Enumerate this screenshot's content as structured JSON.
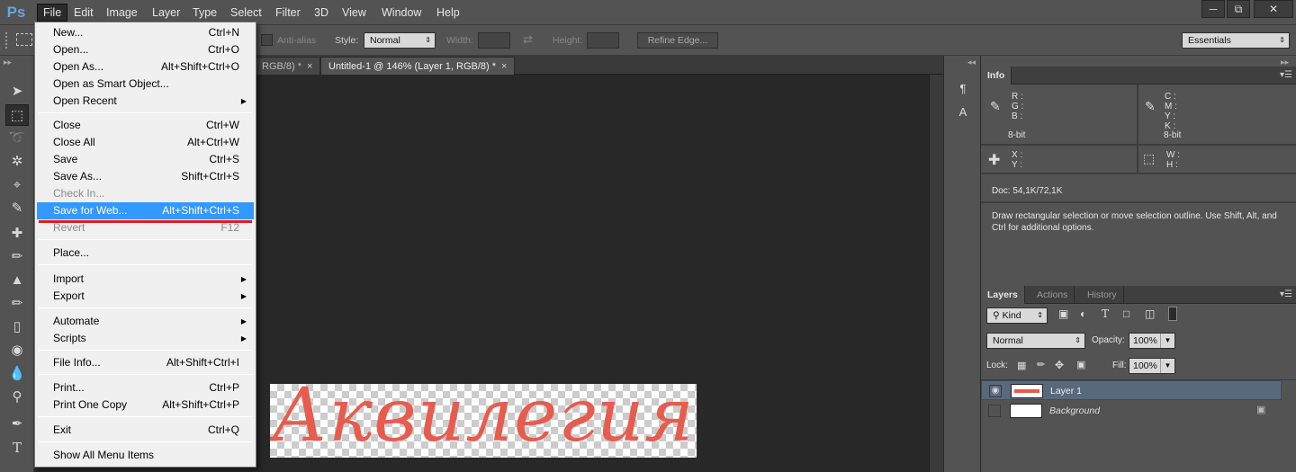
{
  "app": {
    "logo": "Ps"
  },
  "menubar": {
    "items": [
      "File",
      "Edit",
      "Image",
      "Layer",
      "Type",
      "Select",
      "Filter",
      "3D",
      "View",
      "Window",
      "Help"
    ],
    "window_buttons": [
      "minimize-icon",
      "restore-icon",
      "close-icon"
    ]
  },
  "options": {
    "antialias_label": "Anti-alias",
    "style_label": "Style:",
    "style_value": "Normal",
    "width_label": "Width:",
    "height_label": "Height:",
    "refine_edge": "Refine Edge...",
    "workspace": "Essentials"
  },
  "tabs": [
    {
      "label": "RGB/8) *",
      "active": false
    },
    {
      "label": "Untitled-1 @ 146% (Layer 1, RGB/8) *",
      "active": true
    }
  ],
  "canvas": {
    "text": "Аквилегия",
    "text_color": "#e65c4f"
  },
  "file_menu": {
    "items": [
      {
        "label": "New...",
        "shortcut": "Ctrl+N"
      },
      {
        "label": "Open...",
        "shortcut": "Ctrl+O"
      },
      {
        "label": "Open As...",
        "shortcut": "Alt+Shift+Ctrl+O"
      },
      {
        "label": "Open as Smart Object...",
        "shortcut": ""
      },
      {
        "label": "Open Recent",
        "shortcut": "",
        "submenu": true
      },
      {
        "label": "Close",
        "shortcut": "Ctrl+W"
      },
      {
        "label": "Close All",
        "shortcut": "Alt+Ctrl+W"
      },
      {
        "label": "Save",
        "shortcut": "Ctrl+S"
      },
      {
        "label": "Save As...",
        "shortcut": "Shift+Ctrl+S"
      },
      {
        "label": "Check In...",
        "shortcut": "",
        "disabled": true
      },
      {
        "label": "Save for Web...",
        "shortcut": "Alt+Shift+Ctrl+S",
        "highlighted": true
      },
      {
        "label": "Revert",
        "shortcut": "F12",
        "disabled": true
      },
      {
        "label": "Place...",
        "shortcut": ""
      },
      {
        "label": "Import",
        "shortcut": "",
        "submenu": true
      },
      {
        "label": "Export",
        "shortcut": "",
        "submenu": true
      },
      {
        "label": "Automate",
        "shortcut": "",
        "submenu": true
      },
      {
        "label": "Scripts",
        "shortcut": "",
        "submenu": true
      },
      {
        "label": "File Info...",
        "shortcut": "Alt+Shift+Ctrl+I"
      },
      {
        "label": "Print...",
        "shortcut": "Ctrl+P"
      },
      {
        "label": "Print One Copy",
        "shortcut": "Alt+Shift+Ctrl+P"
      },
      {
        "label": "Exit",
        "shortcut": "Ctrl+Q"
      },
      {
        "label": "Show All Menu Items",
        "shortcut": ""
      }
    ]
  },
  "info_panel": {
    "tab": "Info",
    "rgb": [
      "R :",
      "G :",
      "B :"
    ],
    "cmyk": [
      "C :",
      "M :",
      "Y :",
      "K :"
    ],
    "bit_left": "8-bit",
    "bit_right": "8-bit",
    "xy": [
      "X :",
      "Y :"
    ],
    "wh": [
      "W :",
      "H :"
    ],
    "doc": "Doc: 54,1K/72,1K",
    "hint": "Draw rectangular selection or move selection outline.  Use Shift, Alt, and Ctrl for additional options."
  },
  "layers_panel": {
    "tabs": [
      "Layers",
      "Actions",
      "History"
    ],
    "kind": "Kind",
    "blend": "Normal",
    "opacity_label": "Opacity:",
    "opacity": "100%",
    "lock_label": "Lock:",
    "fill_label": "Fill:",
    "fill": "100%",
    "layers": [
      {
        "name": "Layer 1",
        "visible": true,
        "selected": true
      },
      {
        "name": "Background",
        "visible": false,
        "selected": false,
        "locked": true
      }
    ]
  }
}
